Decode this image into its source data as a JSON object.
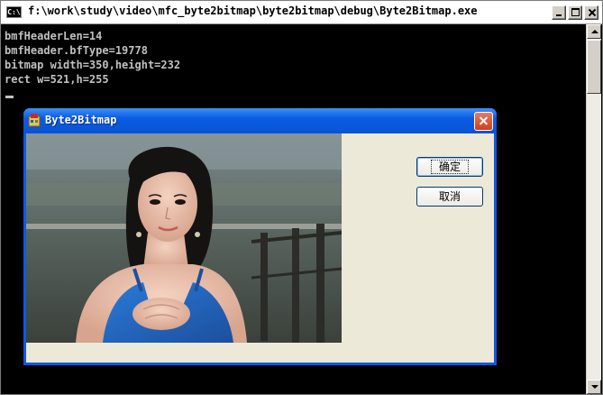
{
  "console": {
    "title": "f:\\work\\study\\video\\mfc_byte2bitmap\\byte2bitmap\\debug\\Byte2Bitmap.exe",
    "icon_text": "C:\\",
    "lines": [
      "bmfHeaderLen=14",
      "bmfHeader.bfType=19778",
      "bitmap width=350,height=232",
      "rect w=521,h=255"
    ]
  },
  "dialog": {
    "title": "Byte2Bitmap",
    "ok_label": "确定",
    "cancel_label": "取消"
  },
  "colors": {
    "console_bg": "#000000",
    "console_text": "#c0c0c0",
    "dialog_title_blue": "#0a5ce1",
    "dialog_client": "#ece9d8"
  },
  "icons": {
    "console": "console-icon",
    "dialog": "app-icon",
    "minimize": "minimize-icon",
    "maximize": "maximize-icon",
    "close": "close-icon"
  }
}
